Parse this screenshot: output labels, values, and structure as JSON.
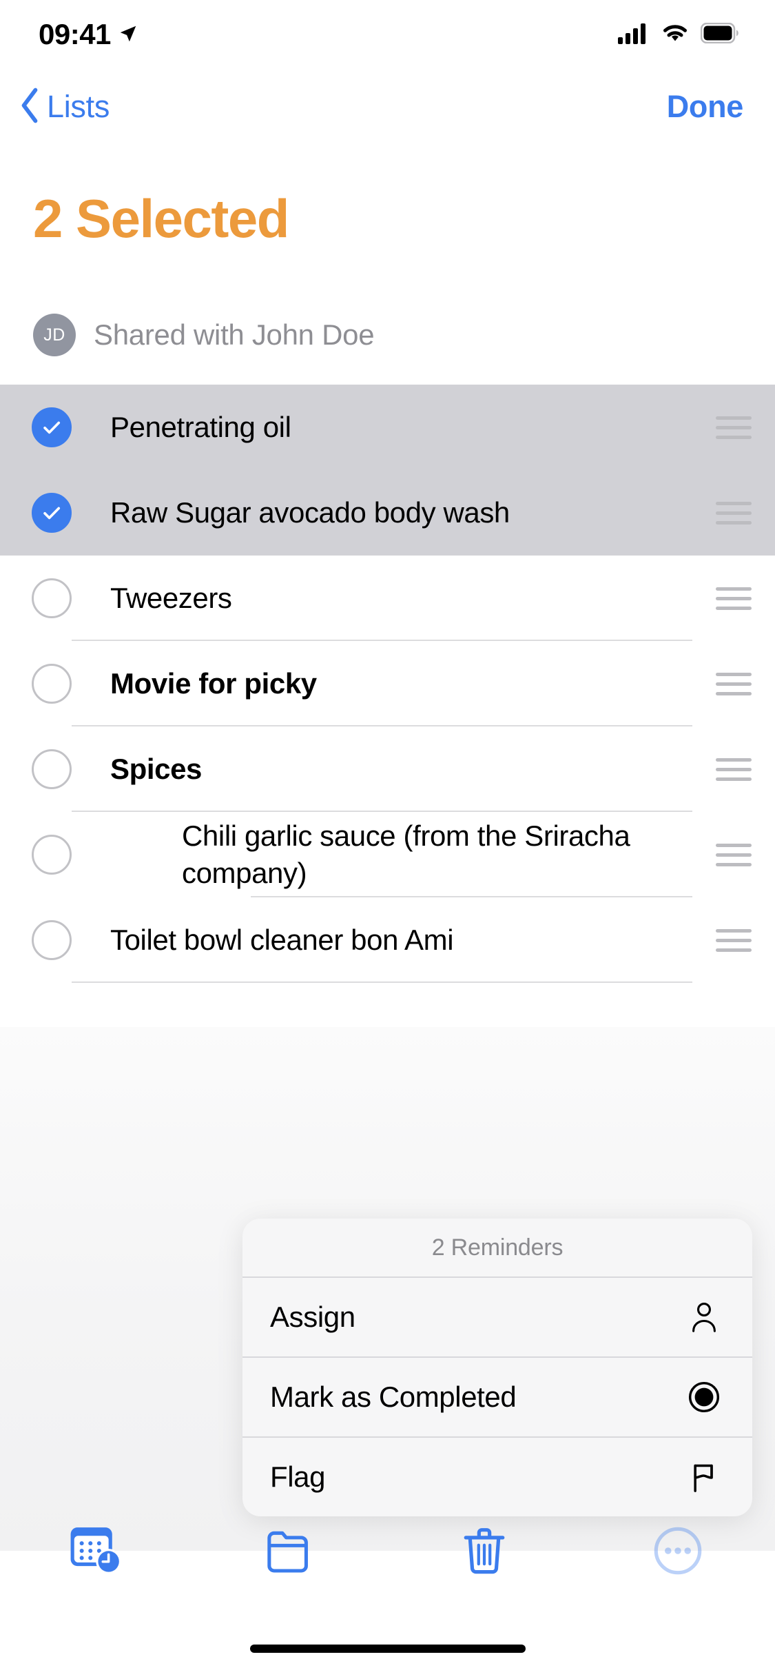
{
  "status_bar": {
    "time": "09:41",
    "location_icon": "location-arrow-icon",
    "cellular_icon": "cellular-signal-icon",
    "wifi_icon": "wifi-icon",
    "battery_icon": "battery-full-icon"
  },
  "nav": {
    "back_icon": "chevron-left-icon",
    "back_label": "Lists",
    "done_label": "Done"
  },
  "header": {
    "title": "2 Selected",
    "title_color": "#ec9a3c"
  },
  "shared": {
    "avatar_initials": "JD",
    "label": "Shared with John Doe"
  },
  "reminders": [
    {
      "text": "Penetrating oil",
      "selected": true,
      "bold": false,
      "indent": false,
      "handle_icon": "drag-handle-icon"
    },
    {
      "text": "Raw Sugar avocado body wash",
      "selected": true,
      "bold": false,
      "indent": false,
      "handle_icon": "drag-handle-icon"
    },
    {
      "text": "Tweezers",
      "selected": false,
      "bold": false,
      "indent": false,
      "handle_icon": "drag-handle-icon"
    },
    {
      "text": "Movie for picky",
      "selected": false,
      "bold": true,
      "indent": false,
      "handle_icon": "drag-handle-icon"
    },
    {
      "text": "Spices",
      "selected": false,
      "bold": true,
      "indent": false,
      "handle_icon": "drag-handle-icon"
    },
    {
      "text": "Chili garlic sauce (from the Sriracha company)",
      "selected": false,
      "bold": false,
      "indent": true,
      "handle_icon": "drag-handle-icon"
    },
    {
      "text": "Toilet bowl cleaner bon Ami",
      "selected": false,
      "bold": false,
      "indent": false,
      "handle_icon": "drag-handle-icon"
    }
  ],
  "action_sheet": {
    "title": "2 Reminders",
    "items": [
      {
        "label": "Assign",
        "icon": "person-icon"
      },
      {
        "label": "Mark as Completed",
        "icon": "filled-circle-icon"
      },
      {
        "label": "Flag",
        "icon": "flag-icon"
      }
    ]
  },
  "toolbar": {
    "buttons": [
      {
        "name": "date-time-button",
        "icon": "calendar-clock-icon",
        "disabled": false
      },
      {
        "name": "move-to-folder-button",
        "icon": "folder-icon",
        "disabled": false
      },
      {
        "name": "delete-button",
        "icon": "trash-icon",
        "disabled": false
      },
      {
        "name": "more-button",
        "icon": "ellipsis-circle-icon",
        "disabled": true
      }
    ]
  },
  "colors": {
    "accent_blue": "#3b7ced",
    "accent_orange": "#ec9a3c",
    "selected_row_bg": "#d1d1d6",
    "secondary_text": "#8e8e93"
  }
}
